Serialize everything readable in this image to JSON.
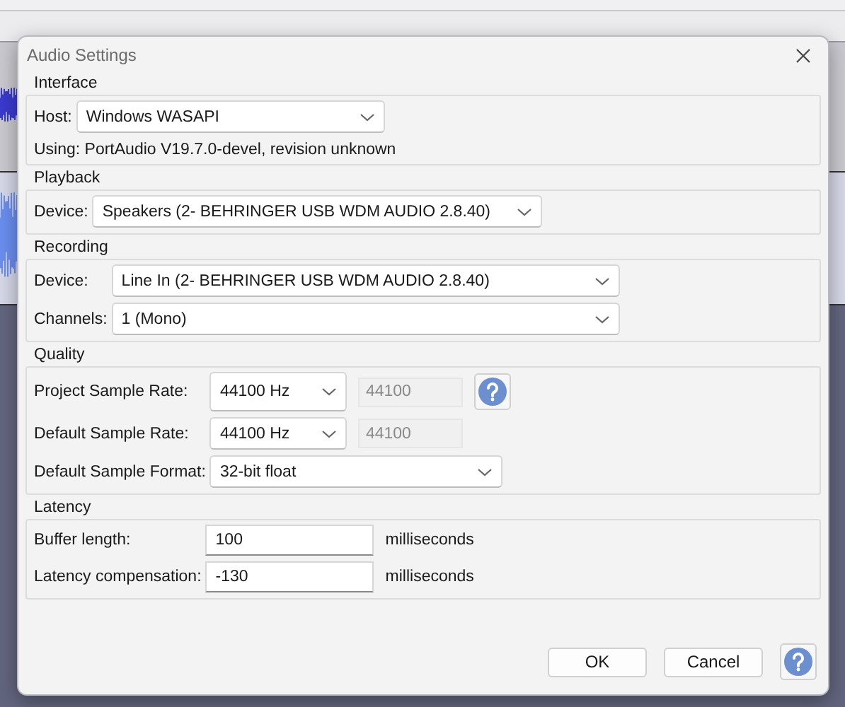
{
  "window": {
    "title": "Audio Settings"
  },
  "sections": [
    {
      "title": "Interface",
      "rows": [
        {
          "kind": "select",
          "label": "Host:",
          "value": "Windows WASAPI"
        },
        {
          "kind": "note",
          "text": "Using: PortAudio V19.7.0-devel, revision unknown"
        }
      ]
    },
    {
      "title": "Playback",
      "rows": [
        {
          "kind": "select",
          "label": "Device:",
          "value": "Speakers (2- BEHRINGER USB WDM AUDIO 2.8.40)"
        }
      ]
    },
    {
      "title": "Recording",
      "rows": [
        {
          "kind": "select",
          "label": "Device:",
          "value": "Line In (2- BEHRINGER USB WDM AUDIO 2.8.40)"
        },
        {
          "kind": "select",
          "label": "Channels:",
          "value": "1 (Mono)"
        }
      ]
    },
    {
      "title": "Quality",
      "rows": [
        {
          "kind": "rate",
          "label": "Project Sample Rate:",
          "value": "44100 Hz",
          "readout": "44100",
          "help": true
        },
        {
          "kind": "rate",
          "label": "Default Sample Rate:",
          "value": "44100 Hz",
          "readout": "44100",
          "help": false
        },
        {
          "kind": "select",
          "label": "Default Sample Format:",
          "value": "32-bit float"
        }
      ]
    },
    {
      "title": "Latency",
      "rows": [
        {
          "kind": "number",
          "label": "Buffer length:",
          "value": "100",
          "unit": "milliseconds"
        },
        {
          "kind": "number",
          "label": "Latency compensation:",
          "value": "-130",
          "unit": "milliseconds"
        }
      ]
    }
  ],
  "buttons": [
    {
      "label": "OK"
    },
    {
      "label": "Cancel"
    }
  ]
}
